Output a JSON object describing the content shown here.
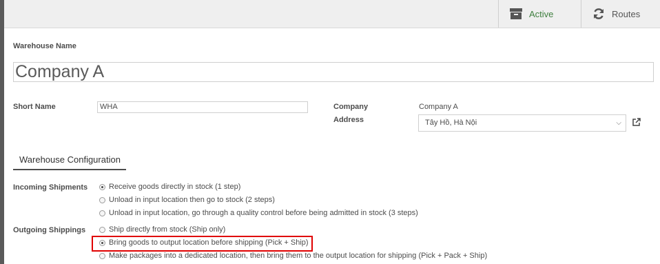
{
  "topbar": {
    "active_label": "Active",
    "routes_label": "Routes"
  },
  "form": {
    "warehouse_name_label": "Warehouse Name",
    "warehouse_name_value": "Company A",
    "short_name_label": "Short Name",
    "short_name_value": "WHA",
    "company_label": "Company",
    "company_value": "Company A",
    "address_label": "Address",
    "address_value": "Tây Hồ, Hà Nội"
  },
  "tabs": {
    "config_label": "Warehouse Configuration"
  },
  "incoming": {
    "label": "Incoming Shipments",
    "options": [
      {
        "label": "Receive goods directly in stock (1 step)",
        "checked": true
      },
      {
        "label": "Unload in input location then go to stock (2 steps)",
        "checked": false
      },
      {
        "label": "Unload in input location, go through a quality control before being admitted in stock (3 steps)",
        "checked": false
      }
    ]
  },
  "outgoing": {
    "label": "Outgoing Shippings",
    "options": [
      {
        "label": "Ship directly from stock (Ship only)",
        "checked": false
      },
      {
        "label": "Bring goods to output location before shipping (Pick + Ship)",
        "checked": true
      },
      {
        "label": "Make packages into a dedicated location, then bring them to the output location for shipping (Pick + Pack + Ship)",
        "checked": false
      }
    ]
  },
  "colors": {
    "active_text": "#3f7f3f",
    "highlight_border": "#e00000"
  }
}
